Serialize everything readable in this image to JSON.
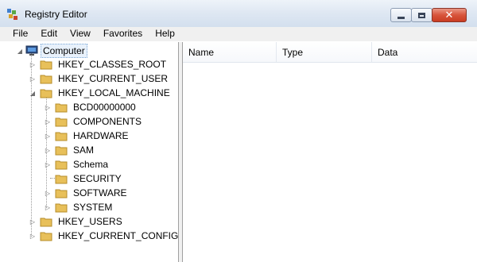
{
  "window": {
    "title": "Registry Editor"
  },
  "caption": {
    "minimize": "minimize",
    "maximize": "maximize",
    "close": "✕"
  },
  "menu": [
    "File",
    "Edit",
    "View",
    "Favorites",
    "Help"
  ],
  "tree": {
    "root": "Computer",
    "hives": [
      {
        "label": "HKEY_CLASSES_ROOT",
        "expanded": false
      },
      {
        "label": "HKEY_CURRENT_USER",
        "expanded": false
      },
      {
        "label": "HKEY_LOCAL_MACHINE",
        "expanded": true,
        "children": [
          "BCD00000000",
          "COMPONENTS",
          "HARDWARE",
          "SAM",
          "Schema",
          "SECURITY",
          "SOFTWARE",
          "SYSTEM"
        ]
      },
      {
        "label": "HKEY_USERS",
        "expanded": false
      },
      {
        "label": "HKEY_CURRENT_CONFIG",
        "expanded": false
      }
    ]
  },
  "list": {
    "columns": [
      "Name",
      "Type",
      "Data"
    ]
  },
  "icons": {
    "app": "registry-editor-icon",
    "root": "computer-icon",
    "folder": "folder-icon"
  },
  "colors": {
    "folder": "#e8c05a",
    "selection": "#e8f1fb",
    "close": "#c93c22"
  }
}
